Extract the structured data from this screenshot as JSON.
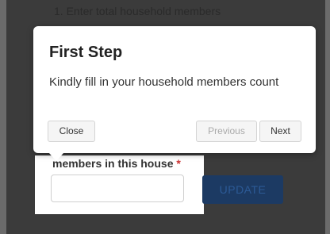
{
  "background": {
    "step_text": "1. Enter total household members"
  },
  "form": {
    "field_label": "members in this house",
    "required_mark": "*",
    "input_value": "",
    "update_label": "UPDATE"
  },
  "popover": {
    "title": "First Step",
    "content": "Kindly fill in your household members count",
    "close_label": "Close",
    "previous_label": "Previous",
    "next_label": "Next",
    "previous_disabled": true
  },
  "colors": {
    "overlay": "#3b3b3b",
    "update_button": "#1c3a63",
    "required": "#cc3333"
  }
}
